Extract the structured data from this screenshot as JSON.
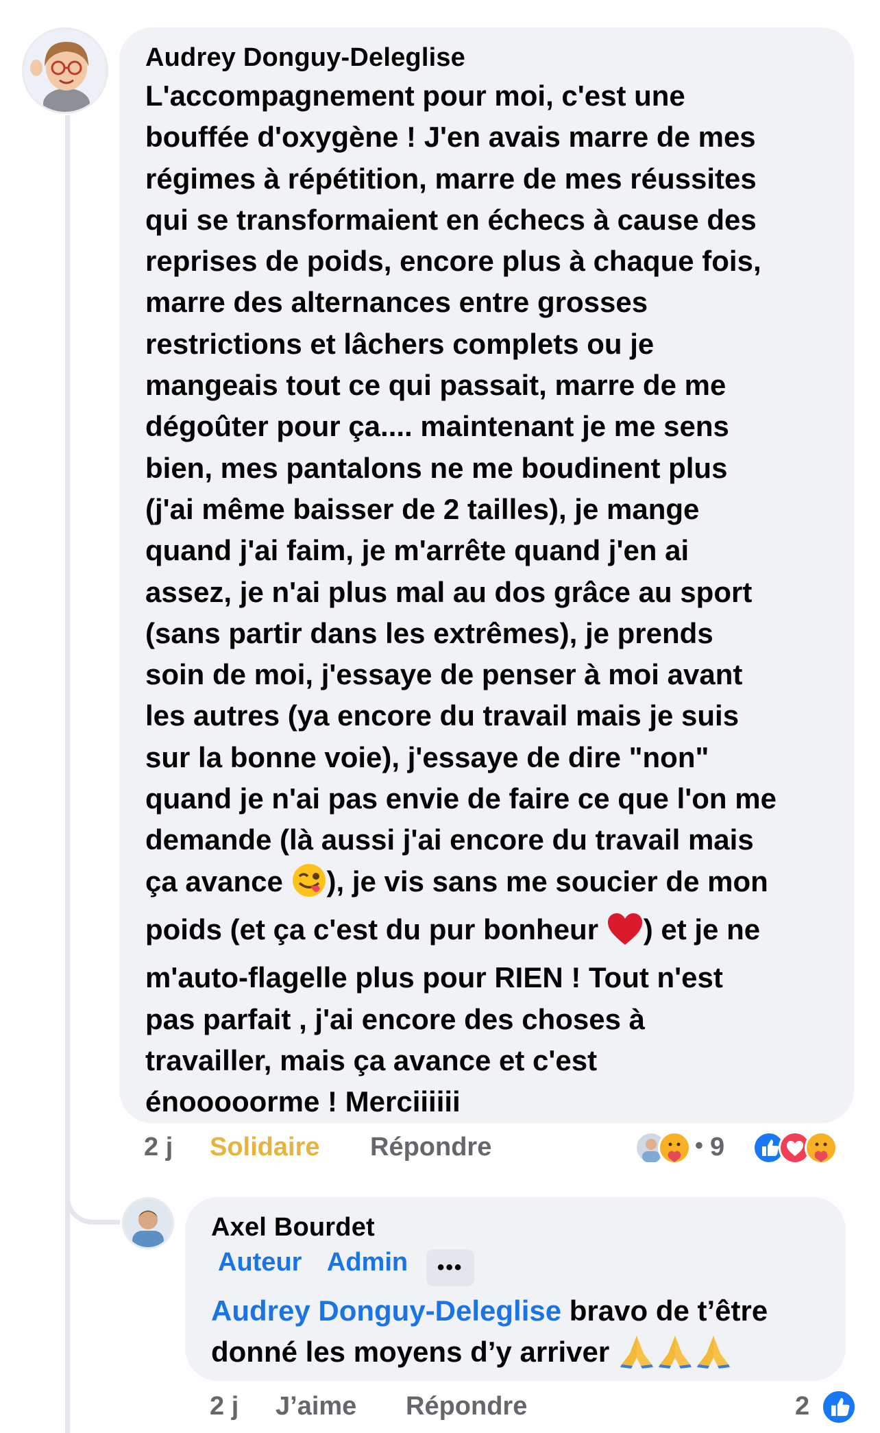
{
  "comment1": {
    "author": "Audrey Donguy-Deleglise",
    "lines": [
      "L'accompagnement pour moi, c'est une",
      "bouffée d'oxygène ! J'en avais marre de mes",
      "régimes à répétition, marre de mes réussites",
      "qui se transformaient en échecs à cause des",
      "reprises de poids, encore plus à chaque fois,",
      "marre des alternances entre grosses",
      "restrictions et lâchers complets ou je",
      "mangeais tout ce qui passait, marre de me",
      "dégoûter pour ça.... maintenant je me sens",
      "bien, mes pantalons ne me boudinent plus",
      "(j'ai même baisser de 2 tailles), je mange",
      "quand j'ai faim, je m'arrête quand j'en ai",
      "assez, je n'ai plus mal au dos grâce au sport",
      "(sans partir dans les extrêmes), je prends",
      "soin de moi, j'essaye de penser à moi avant",
      "les autres (ya encore du travail mais je suis",
      "sur la bonne voie), j'essaye de dire \"non\"",
      "quand je n'ai pas envie de faire ce que l'on me",
      "demande (là aussi j'ai encore du travail mais"
    ],
    "line20_before": "ça avance ",
    "line20_after": "), je vis sans me soucier de mon",
    "line21_before": "poids (et ça c'est du pur bonheur ",
    "line21_after": ") et je ne",
    "lines_end": [
      "m'auto-flagelle plus pour RIEN ! Tout n'est",
      "pas parfait , j'ai encore des choses à",
      "travailler, mais ça avance et c'est",
      "énooooorme ! Merciiiiii"
    ],
    "time": "2 j",
    "reaction_label": "Solidaire",
    "reply_label": "Répondre",
    "reaction_count": "9",
    "reaction_dot": "•"
  },
  "comment2": {
    "author": "Axel Bourdet",
    "badges": [
      "Auteur",
      "Admin"
    ],
    "more_label": "•••",
    "mention": "Audrey Donguy-Deleglise",
    "text_after_mention": " bravo de t’être",
    "line2": "donné les moyens d’y arriver ",
    "time": "2 j",
    "like_label": "J’aime",
    "reply_label": "Répondre",
    "like_count": "2"
  },
  "icons": {
    "wink_emoji": "winking-face-tongue-icon",
    "heart_emoji": "red-heart-icon",
    "pray_emoji": "folded-hands-icon",
    "like_reaction": "like-icon",
    "love_reaction": "love-icon",
    "care_reaction": "care-icon"
  },
  "colors": {
    "bubble": "#f0f2f5",
    "meta": "#65676b",
    "link": "#1b74e4",
    "solidaire": "#e8b33b",
    "like_blue": "#1877f2",
    "love_red": "#f33e58"
  }
}
